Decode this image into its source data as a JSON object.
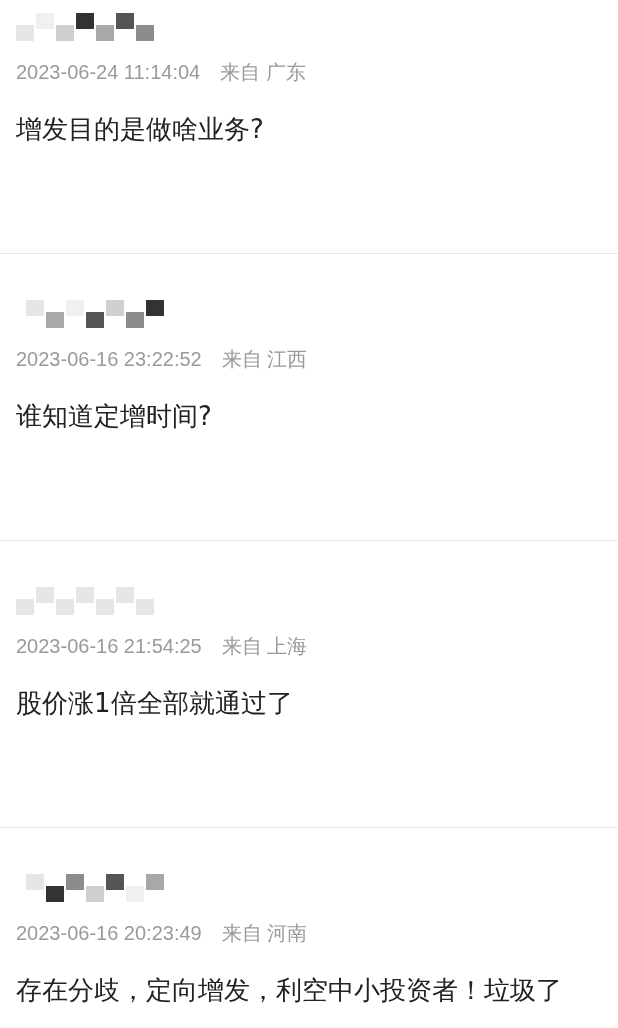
{
  "comments": [
    {
      "time": "2023-06-24 11:14:04",
      "source": "来自 广东",
      "text": "增发目的是做啥业务?"
    },
    {
      "time": "2023-06-16 23:22:52",
      "source": "来自 江西",
      "text": "谁知道定增时间?"
    },
    {
      "time": "2023-06-16 21:54:25",
      "source": "来自 上海",
      "text": "股价涨1倍全部就通过了"
    },
    {
      "time": "2023-06-16 20:23:49",
      "source": "来自 河南",
      "text": "存在分歧，定向增发，利空中小投资者！垃圾了"
    }
  ]
}
